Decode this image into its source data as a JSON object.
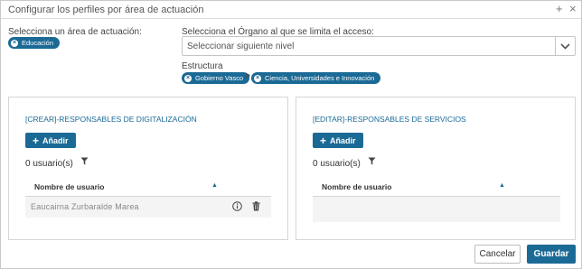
{
  "dialog": {
    "title": "Configurar los perfiles por área de actuación",
    "plus_icon": "+",
    "close_icon": "×"
  },
  "area": {
    "label": "Selecciona un área de actuación:",
    "chip": "Educación"
  },
  "organ": {
    "label": "Selecciona el Órgano al que se limita el acceso:",
    "select_value": "Seleccionar siguiente nivel"
  },
  "estructura": {
    "label": "Estructura",
    "items": [
      "Gobierno Vasco",
      "Ciencia, Universidades e Innovación"
    ],
    "separator": ">"
  },
  "panels": [
    {
      "title": "[CREAR]-RESPONSABLES DE DIGITALIZACIÓN",
      "add_label": "Añadir",
      "count": "0 usuario(s)",
      "column": "Nombre de usuario",
      "sort_icon": "▲",
      "rows": [
        "Eaucairna Zurbaralde Marea"
      ]
    },
    {
      "title": "[EDITAR]-RESPONSABLES DE SERVICIOS",
      "add_label": "Añadir",
      "count": "0 usuario(s)",
      "column": "Nombre de usuario",
      "sort_icon": "▲",
      "rows": []
    }
  ],
  "footer": {
    "cancel": "Cancelar",
    "save": "Guardar"
  },
  "colors": {
    "accent": "#1b6a96"
  }
}
